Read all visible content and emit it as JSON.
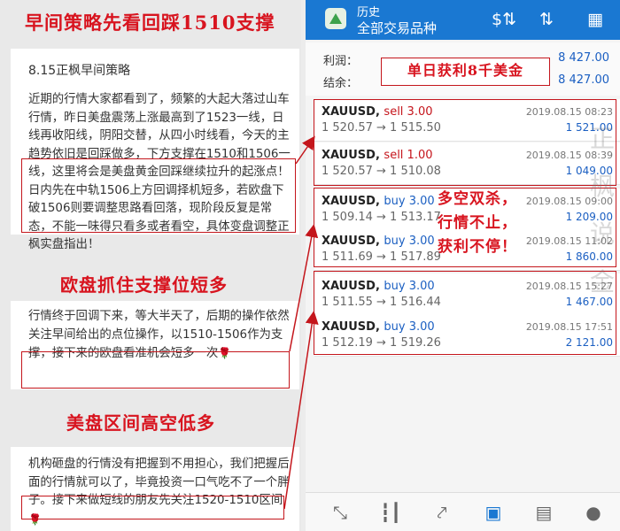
{
  "left": {
    "heading1": "早间策略先看回踩1510支撑",
    "card1_title": "8.15正枫早间策略",
    "card1_text": "近期的行情大家都看到了，频繁的大起大落过山车行情，昨日美盘震荡上涨最高到了1523一线，日线再收阳线，阴阳交替，从四小时线看，今天的主趋势依旧是回踩做多，下方支撑在1510和1506一线，这里将会是美盘黄金回踩继续拉升的起涨点！日内先在中轨1506上方回调择机短多，若欧盘下破1506则要调整思路看回落，现阶段反复是常态，不能一味得只看多或者看空，具体变盘调整正枫实盘指出！",
    "heading2": "欧盘抓住支撑位短多",
    "card2_text": "行情终于回调下来，等大半天了，后期的操作依然关注早间给出的点位操作，以1510-1506作为支撑，接下来的欧盘看准机会短多一次",
    "heading3": "美盘区间高空低多",
    "card3_text": "机构砸盘的行情没有把握到不用担心，我们把握后面的行情就可以了，毕竟投资一口气吃不了一个胖子。接下来做短线的朋友先关注1520-1510区间",
    "rose": "🌹"
  },
  "app": {
    "title": "历史",
    "subtitle": "全部交易品种",
    "icons": [
      "currency-exchange-icon",
      "sort-icon",
      "calendar-icon"
    ]
  },
  "summary": {
    "profit_label": "利润：",
    "profit_value": "8 427.00",
    "balance_label": "结余：",
    "balance_value": "8 427.00",
    "banner": "单日获利8千美金"
  },
  "trades": [
    {
      "symbol": "XAUUSD,",
      "side": "sell 3.00",
      "type": "sell",
      "prices": "1 520.57 → 1 515.50",
      "date": "2019.08.15 08:23",
      "profit": "1 521.00"
    },
    {
      "symbol": "XAUUSD,",
      "side": "sell 1.00",
      "type": "sell",
      "prices": "1 520.57 → 1 510.08",
      "date": "2019.08.15 08:39",
      "profit": "1 049.00"
    },
    {
      "symbol": "XAUUSD,",
      "side": "buy 3.00",
      "type": "buy",
      "prices": "1 509.14 → 1 513.17",
      "date": "2019.08.15 09:00",
      "profit": "1 209.00"
    },
    {
      "symbol": "XAUUSD,",
      "side": "buy 3.00",
      "type": "buy",
      "prices": "1 511.69 → 1 517.89",
      "date": "2019.08.15 11:02",
      "profit": "1 860.00"
    },
    {
      "symbol": "XAUUSD,",
      "side": "buy 3.00",
      "type": "buy",
      "prices": "1 511.55 → 1 516.44",
      "date": "2019.08.15 15:27",
      "profit": "1 467.00"
    },
    {
      "symbol": "XAUUSD,",
      "side": "buy 3.00",
      "type": "buy",
      "prices": "1 512.19 → 1 519.26",
      "date": "2019.08.15 17:51",
      "profit": "2 121.00"
    }
  ],
  "overlay": {
    "line1": "多空双杀，",
    "line2": "行情不止，",
    "line3": "获利不停！"
  },
  "watermark": [
    "正",
    "枫",
    "说",
    "金"
  ],
  "nav": [
    "trade-icon",
    "candlestick-chart-icon",
    "line-chart-icon",
    "inbox-icon",
    "news-icon",
    "chat-icon"
  ],
  "colors": {
    "accent": "#1a78d2",
    "annotation_red": "#c4161c",
    "profit_blue": "#1b5fc2",
    "sell_red": "#c5141b"
  }
}
